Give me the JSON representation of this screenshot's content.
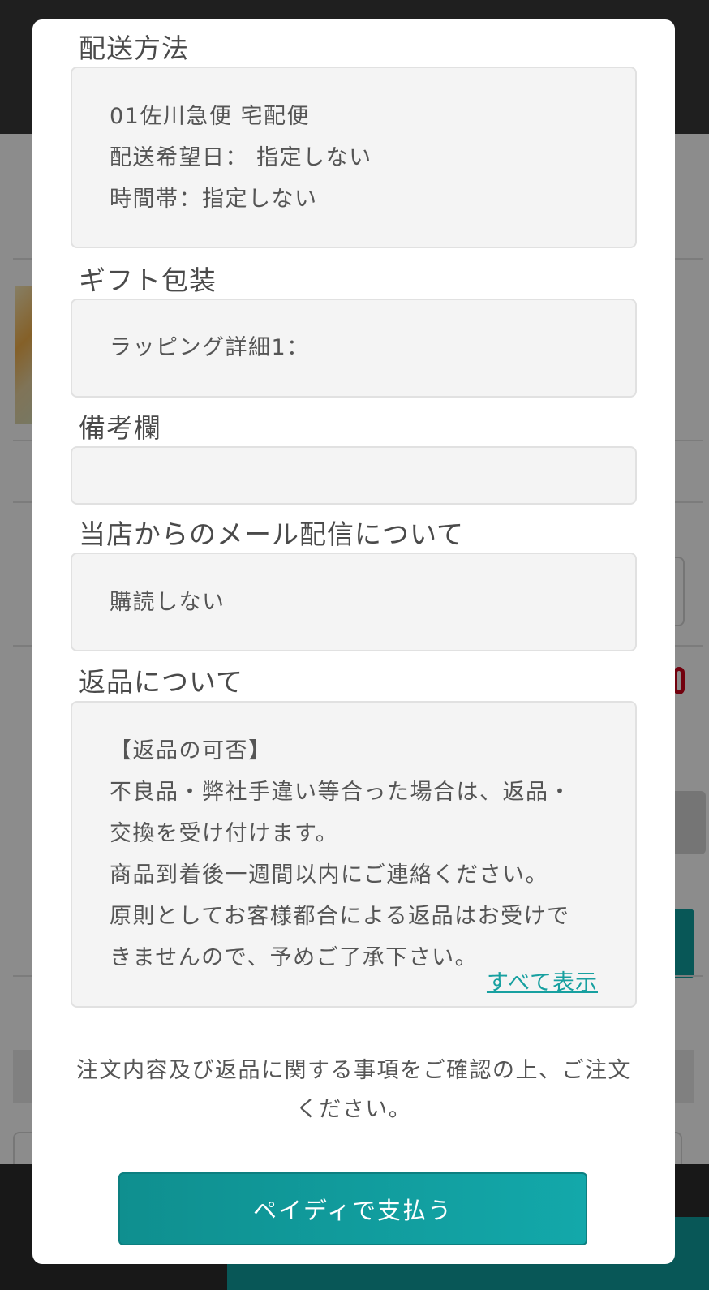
{
  "shipping": {
    "title": "配送方法",
    "lines": [
      "01佐川急便 宅配便",
      "配送希望日： 指定しない",
      "時間帯：指定しない"
    ]
  },
  "gift": {
    "title": "ギフト包装",
    "lines": [
      "ラッピング詳細1："
    ]
  },
  "remarks": {
    "title": "備考欄",
    "value": ""
  },
  "mail": {
    "title": "当店からのメール配信について",
    "lines": [
      "購読しない"
    ]
  },
  "returns": {
    "title": "返品について",
    "lines": [
      "【返品の可否】",
      "不良品・弊社手違い等合った場合は、返品・",
      "交換を受け付けます。",
      "商品到着後一週間以内にご連絡ください。",
      "原則としてお客様都合による返品はお受けで",
      "きませんので、予めご了承下さい。"
    ],
    "show_all_label": "すべて表示"
  },
  "confirm_text": "注文内容及び返品に関する事項をご確認の上、ご注文ください。",
  "pay_button_label": "ペイディで支払う",
  "colors": {
    "accent": "#13a8aa",
    "box_bg": "#f4f4f4",
    "text": "#555555"
  }
}
